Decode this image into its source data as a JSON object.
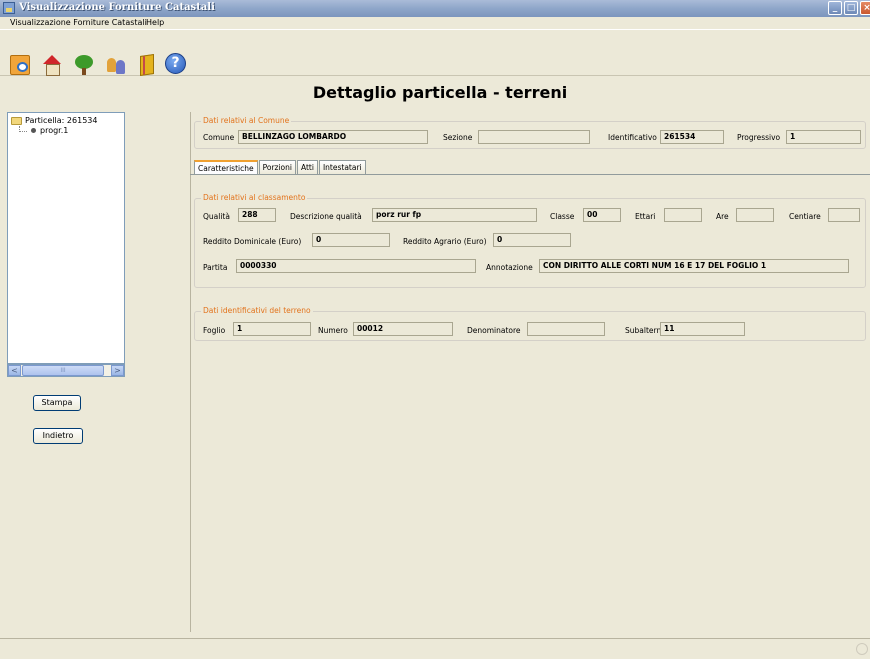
{
  "window": {
    "title": "Visualizzazione Forniture Catastali",
    "minimize": "_",
    "maximize": "□",
    "close": "×"
  },
  "menu": {
    "items": [
      "Visualizzazione Forniture Catastali",
      "Help"
    ]
  },
  "toolbar": {
    "icons": [
      "folder-search-icon",
      "house-icon",
      "tree-icon",
      "people-icon",
      "book-icon",
      "help-icon"
    ],
    "help_glyph": "?"
  },
  "page_title": "Dettaglio particella - terreni",
  "tree": {
    "root_label": "Particella: 261534",
    "child_label": "progr.1"
  },
  "scrollbar": {
    "left_arrow": "<",
    "right_arrow": ">",
    "grip": "III"
  },
  "buttons": {
    "print": "Stampa",
    "back": "Indietro"
  },
  "comune_group": {
    "title": "Dati relativi al Comune",
    "comune_label": "Comune",
    "comune_value": "BELLINZAGO LOMBARDO",
    "sezione_label": "Sezione",
    "sezione_value": "",
    "identificativo_label": "Identificativo",
    "identificativo_value": "261534",
    "progressivo_label": "Progressivo",
    "progressivo_value": "1"
  },
  "tabs": [
    "Caratteristiche",
    "Porzioni",
    "Atti",
    "Intestatari"
  ],
  "classamento_group": {
    "title": "Dati relativi al classamento",
    "qualita_label": "Qualità",
    "qualita_value": "288",
    "descrizione_label": "Descrizione qualità",
    "descrizione_value": "porz rur fp",
    "classe_label": "Classe",
    "classe_value": "00",
    "ettari_label": "Ettari",
    "ettari_value": "",
    "are_label": "Are",
    "are_value": "",
    "centiare_label": "Centiare",
    "centiare_value": "",
    "reddito_dom_label": "Reddito Dominicale (Euro)",
    "reddito_dom_value": "0",
    "reddito_agr_label": "Reddito Agrario (Euro)",
    "reddito_agr_value": "0",
    "partita_label": "Partita",
    "partita_value": "0000330",
    "annotazione_label": "Annotazione",
    "annotazione_value": "CON DIRITTO ALLE CORTI NUM 16 E 17 DEL FOGLIO 1"
  },
  "terreno_group": {
    "title": "Dati identificativi del terreno",
    "foglio_label": "Foglio",
    "foglio_value": "1",
    "numero_label": "Numero",
    "numero_value": "00012",
    "denominatore_label": "Denominatore",
    "denominatore_value": "",
    "subalterno_label": "Subalterno",
    "subalterno_value": "11"
  }
}
